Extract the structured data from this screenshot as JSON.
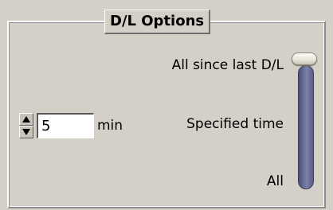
{
  "group": {
    "title": "D/L Options"
  },
  "interval": {
    "value": "5",
    "unit": "min"
  },
  "download_mode": {
    "options": [
      "All since last D/L",
      "Specified time",
      "All"
    ],
    "selected": "All since last D/L"
  },
  "colors": {
    "background": "#d4d0c8",
    "slider_track": "#6c7096",
    "slider_thumb": "#ece9df"
  }
}
